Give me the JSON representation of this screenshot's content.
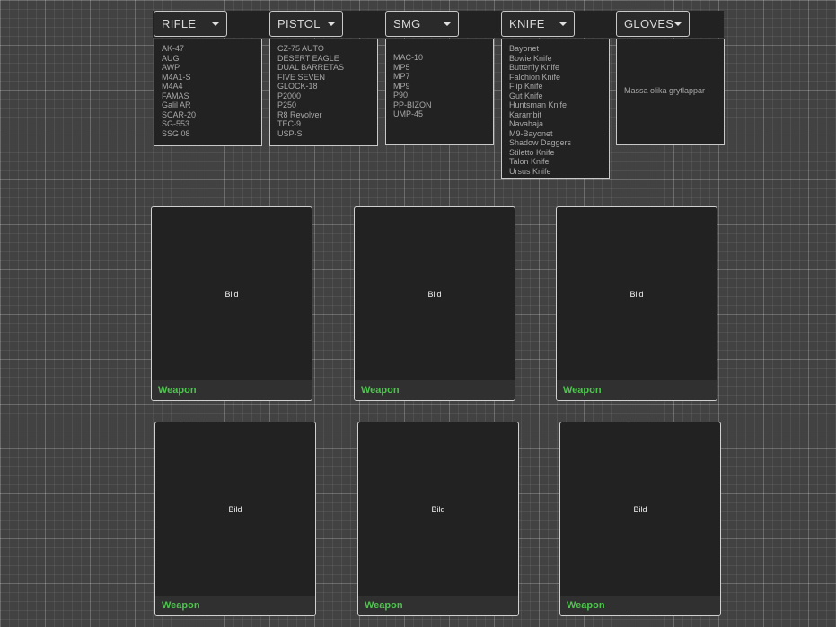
{
  "categories": [
    {
      "label": "RIFLE",
      "items": [
        "AK-47",
        "AUG",
        "AWP",
        "M4A1-S",
        "M4A4",
        "FAMAS",
        "Galil AR",
        "SCAR-20",
        "SG-553",
        "SSG 08"
      ]
    },
    {
      "label": "PISTOL",
      "items": [
        "CZ-75 AUTO",
        "DESERT EAGLE",
        "DUAL BARRETAS",
        "FIVE SEVEN",
        "GLOCK-18",
        "P2000",
        "P250",
        "R8 Revolver",
        "TEC-9",
        "USP-S"
      ]
    },
    {
      "label": "SMG",
      "items": [
        "MAC-10",
        "MP5",
        "MP7",
        "MP9",
        "P90",
        "PP-BIZON",
        "UMP-45"
      ]
    },
    {
      "label": "KNIFE",
      "items": [
        "Bayonet",
        "Bowie Knife",
        "Butterfly Knife",
        "Falchion Knife",
        "Flip Knife",
        "Gut Knife",
        "Huntsman Knife",
        "Karambit",
        "Navahaja",
        "M9-Bayonet",
        "Shadow Daggers",
        "Stiletto Knife",
        "Talon Knife",
        "Ursus Knife"
      ]
    },
    {
      "label": "GLOVES",
      "note": "Massa olika grytlappar"
    }
  ],
  "cards": [
    {
      "image_label": "Bild",
      "caption": "Weapon"
    },
    {
      "image_label": "Bild",
      "caption": "Weapon"
    },
    {
      "image_label": "Bild",
      "caption": "Weapon"
    },
    {
      "image_label": "Bild",
      "caption": "Weapon"
    },
    {
      "image_label": "Bild",
      "caption": "Weapon"
    },
    {
      "image_label": "Bild",
      "caption": "Weapon"
    }
  ],
  "colors": {
    "accent_caption": "#4ec44e",
    "panel": "#222222",
    "background": "#424242"
  }
}
